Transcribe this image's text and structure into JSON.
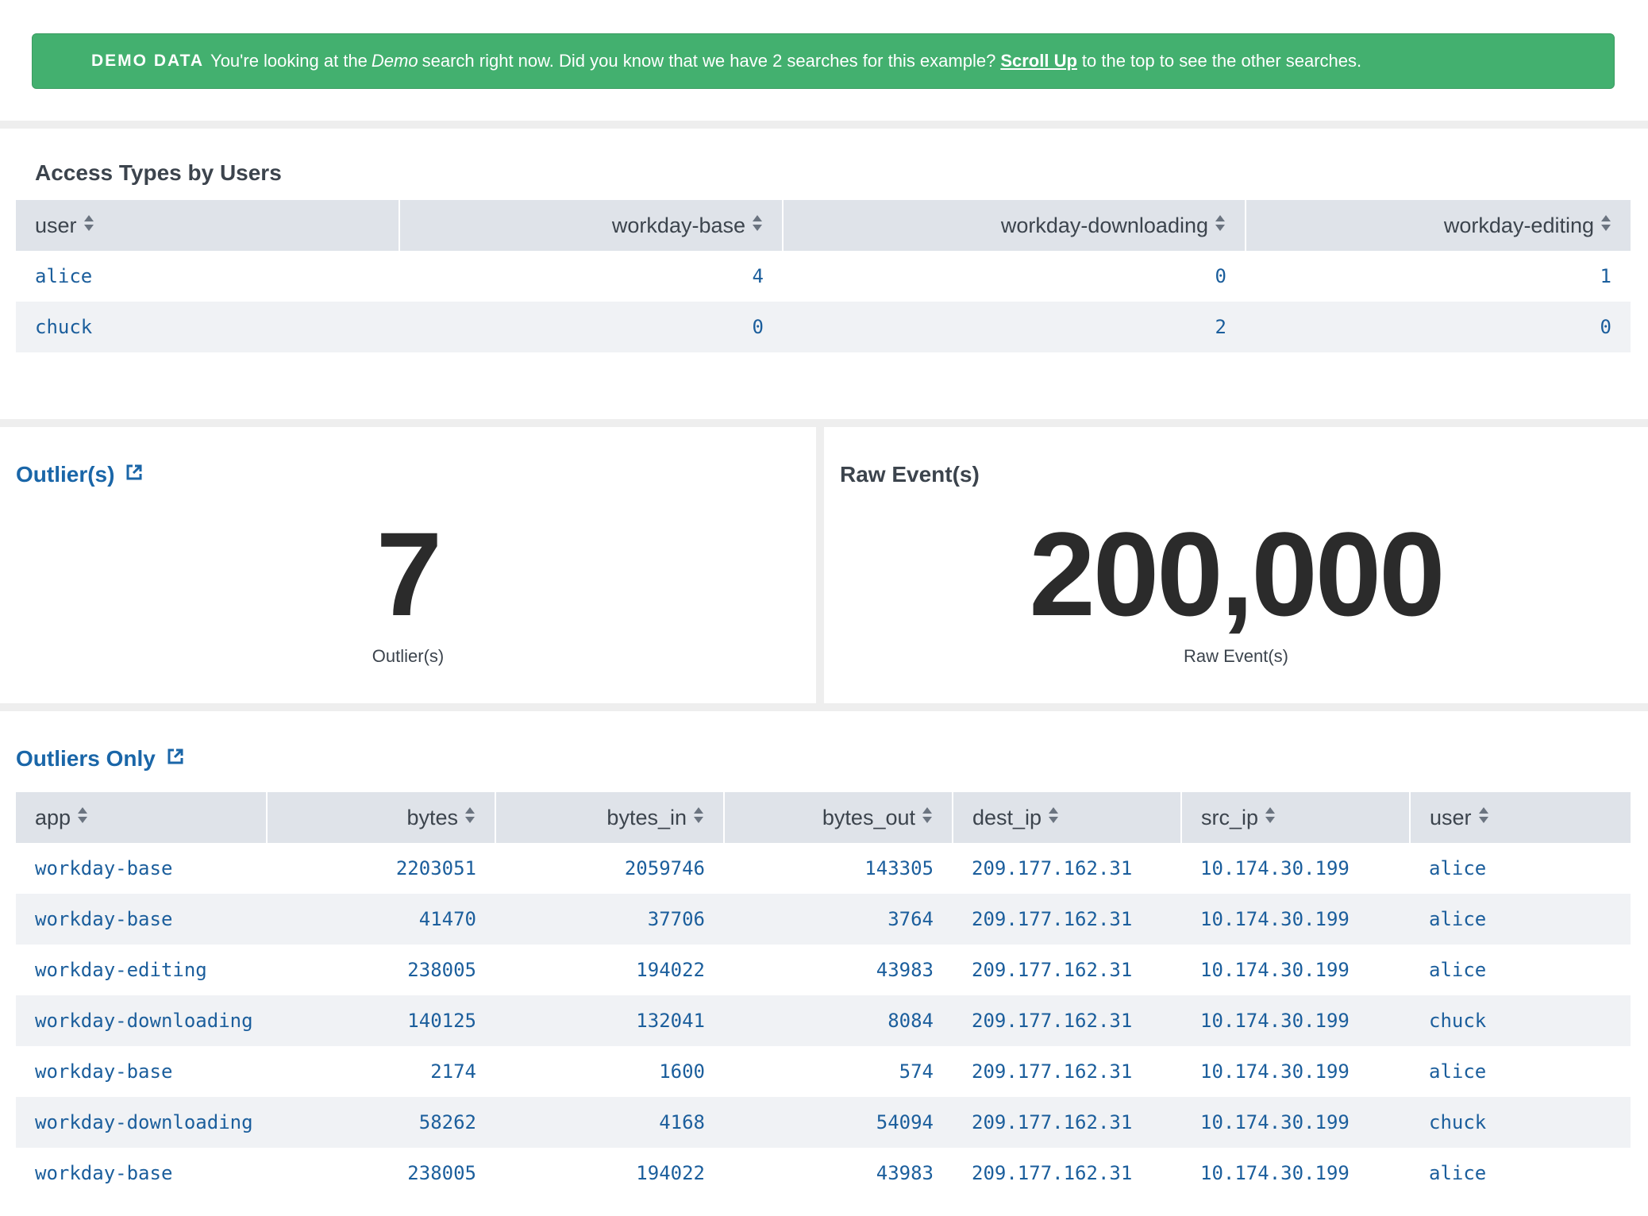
{
  "banner": {
    "tag": "DEMO DATA",
    "text1": "You're looking at the",
    "em": "Demo",
    "text2": "search right now. Did you know that we have 2 searches for this example?",
    "link": "Scroll Up",
    "text3": "to the top to see the other searches."
  },
  "access_table": {
    "title": "Access Types by Users",
    "headers": [
      "user",
      "workday-base",
      "workday-downloading",
      "workday-editing"
    ],
    "rows": [
      [
        "alice",
        "4",
        "0",
        "1"
      ],
      [
        "chuck",
        "0",
        "2",
        "0"
      ]
    ]
  },
  "outliers": {
    "title": "Outlier(s)",
    "value": "7",
    "label": "Outlier(s)"
  },
  "raw_events": {
    "title": "Raw Event(s)",
    "value": "200,000",
    "label": "Raw Event(s)"
  },
  "outliers_table": {
    "title": "Outliers Only",
    "headers": [
      "app",
      "bytes",
      "bytes_in",
      "bytes_out",
      "dest_ip",
      "src_ip",
      "user"
    ],
    "rows": [
      [
        "workday-base",
        "2203051",
        "2059746",
        "143305",
        "209.177.162.31",
        "10.174.30.199",
        "alice"
      ],
      [
        "workday-base",
        "41470",
        "37706",
        "3764",
        "209.177.162.31",
        "10.174.30.199",
        "alice"
      ],
      [
        "workday-editing",
        "238005",
        "194022",
        "43983",
        "209.177.162.31",
        "10.174.30.199",
        "alice"
      ],
      [
        "workday-downloading",
        "140125",
        "132041",
        "8084",
        "209.177.162.31",
        "10.174.30.199",
        "chuck"
      ],
      [
        "workday-base",
        "2174",
        "1600",
        "574",
        "209.177.162.31",
        "10.174.30.199",
        "alice"
      ],
      [
        "workday-downloading",
        "58262",
        "4168",
        "54094",
        "209.177.162.31",
        "10.174.30.199",
        "chuck"
      ],
      [
        "workday-base",
        "238005",
        "194022",
        "43983",
        "209.177.162.31",
        "10.174.30.199",
        "alice"
      ]
    ]
  },
  "colors": {
    "banner_bg": "#43b06f",
    "link_blue": "#1a66a8",
    "cell_blue": "#1b5e9c",
    "header_bg": "#dfe3e9",
    "stripe_bg": "#f0f2f5"
  },
  "icons": {
    "sort": "sort-icon",
    "external": "external-link-icon"
  }
}
